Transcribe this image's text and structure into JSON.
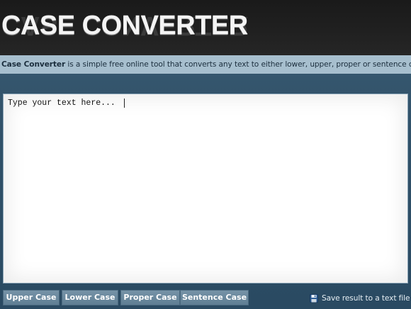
{
  "header": {
    "title": "CASE CONVERTER"
  },
  "tagline": {
    "brand": "Case Converter",
    "text": " is a simple free online tool that converts any text to either lower, upper, proper or sentence case."
  },
  "editor": {
    "placeholder": "Type your text here..."
  },
  "buttons": {
    "upper_case": "Upper Case",
    "lower_case": "Lower Case",
    "proper_case": "Proper Case",
    "sentence_case": "Sentence Case"
  },
  "save": {
    "label": "Save result to a text file",
    "icon": "floppy-disk-icon"
  },
  "colors": {
    "header_bg": "#1f1f1f",
    "tagline_bg": "#a7bfce",
    "page_bg": "#2f5068",
    "button_bg": "#6a8aa0"
  }
}
